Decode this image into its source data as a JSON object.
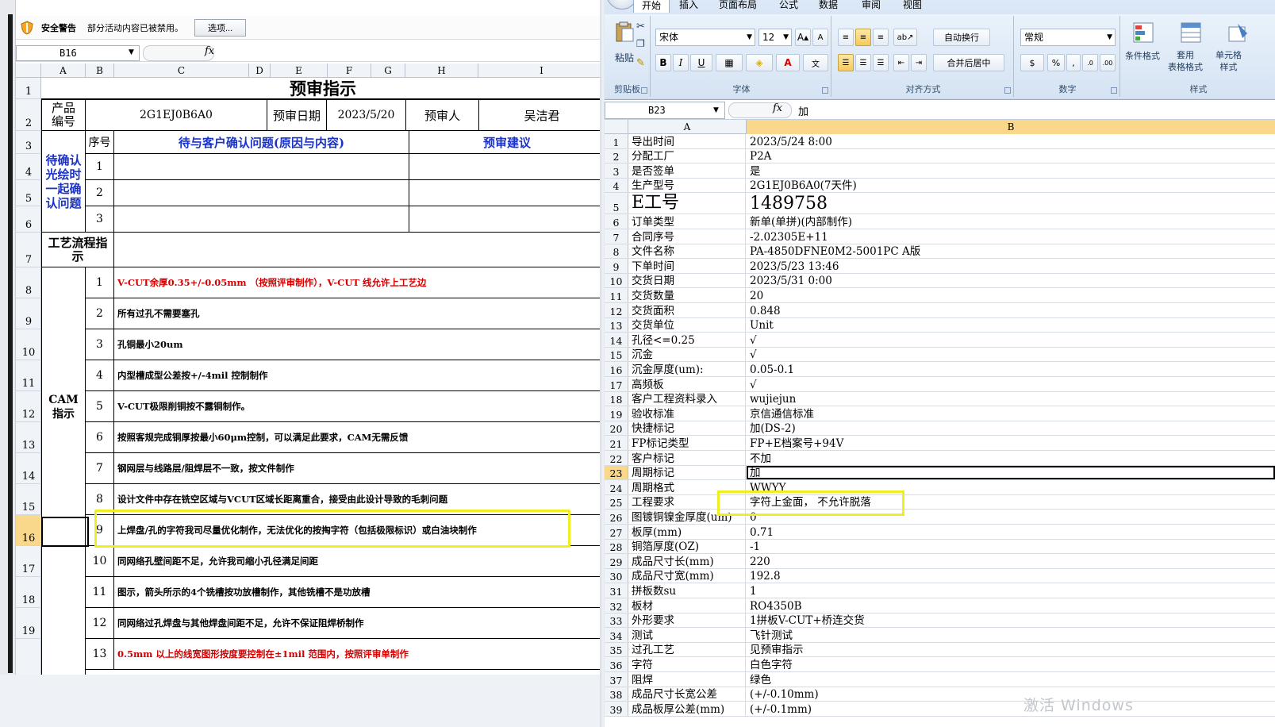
{
  "left": {
    "security_bar": {
      "title": "安全警告",
      "message": "部分活动内容已被禁用。",
      "options_button": "选项..."
    },
    "name_box": "B16",
    "fx_label": "fx",
    "columns": [
      "A",
      "B",
      "C",
      "D",
      "E",
      "F",
      "G",
      "H",
      "I"
    ],
    "rows": [
      "1",
      "2",
      "3",
      "4",
      "5",
      "6",
      "7",
      "8",
      "9",
      "10",
      "11",
      "12",
      "13",
      "14",
      "15",
      "16",
      "17",
      "18",
      "19"
    ],
    "title": "预审指示",
    "product_code_label": "产品编号",
    "product_code": "2G1EJ0B6A0",
    "review_date_label": "预审日期",
    "review_date": "2023/5/20",
    "reviewer_label": "预审人",
    "reviewer": "吴洁君",
    "seq_header": "序号",
    "issue_header": "待与客户确认问题(原因与内容)",
    "suggestion_header": "预审建议",
    "confirm_label": "待确认光绘时一起确认问题",
    "confirm_items": [
      "1",
      "2",
      "3"
    ],
    "process_label": "工艺流程指示",
    "cam_label": "CAM指示",
    "cam_items": [
      {
        "no": "1",
        "text": "V-CUT余厚0.35+/-0.05mm （按照评审制作），V-CUT 线允许上工艺边",
        "color": "#d40000"
      },
      {
        "no": "2",
        "text": "所有过孔不需要塞孔"
      },
      {
        "no": "3",
        "text": "孔铜最小20um"
      },
      {
        "no": "4",
        "text": "内型槽成型公差按+/-4mil 控制制作"
      },
      {
        "no": "5",
        "text": "V-CUT极限削铜按不露铜制作。"
      },
      {
        "no": "6",
        "text": "按照客规完成铜厚按最小60μm控制，可以满足此要求，CAM无需反馈"
      },
      {
        "no": "7",
        "text": "钢网层与线路层/阻焊层不一致，按文件制作"
      },
      {
        "no": "8",
        "text": "设计文件中存在铣空区域与VCUT区域长距离重合，接受由此设计导致的毛刺问题"
      },
      {
        "no": "9",
        "text": "上焊盘/孔的字符我司尽量优化制作，无法优化的按掏字符（包括极限标识）或白油块制作"
      },
      {
        "no": "10",
        "text": "同网络孔壁间距不足，允许我司缩小孔径满足间距"
      },
      {
        "no": "11",
        "text": "图示，箭头所示的4个铣槽按功放槽制作，其他铣槽不是功放槽"
      },
      {
        "no": "12",
        "text": "同网络过孔焊盘与其他焊盘间距不足，允许不保证阻焊桥制作"
      },
      {
        "no": "13",
        "text": "0.5mm 以上的线宽图形按度要控制在±1mil 范围内，按照评审单制作",
        "color": "#d40000"
      }
    ]
  },
  "right": {
    "tabs": [
      "开始",
      "插入",
      "页面布局",
      "公式",
      "数据",
      "审阅",
      "视图"
    ],
    "ribbon": {
      "paste": "粘贴",
      "clipboard": "剪贴板",
      "font_name": "宋体",
      "font_size": "12",
      "font_group": "字体",
      "wrap_text": "自动换行",
      "merge_center": "合并后居中",
      "align_group": "对齐方式",
      "number_format": "常规",
      "number_group": "数字",
      "cond_format": "条件格式",
      "table_format": "套用\n表格格式",
      "cell_style": "单元格\n样式",
      "styles_group": "样式"
    },
    "name_box": "B23",
    "fx_label": "fx",
    "formula_value": "加",
    "columns": [
      "A",
      "B"
    ],
    "rows": [
      {
        "n": "1",
        "a": "导出时间",
        "b": "2023/5/24 8:00"
      },
      {
        "n": "2",
        "a": "分配工厂",
        "b": "P2A"
      },
      {
        "n": "3",
        "a": "是否签单",
        "b": "是"
      },
      {
        "n": "4",
        "a": "生产型号",
        "b": "2G1EJ0B6A0(7天件)"
      },
      {
        "n": "5",
        "a": "E工号",
        "b": "1489758"
      },
      {
        "n": "6",
        "a": "订单类型",
        "b": "新单(单拼)(内部制作)"
      },
      {
        "n": "7",
        "a": "合同序号",
        "b": "-2.02305E+11"
      },
      {
        "n": "8",
        "a": "文件名称",
        "b": "PA-4850DFNE0M2-5001PC A版"
      },
      {
        "n": "9",
        "a": "下单时间",
        "b": "2023/5/23 13:46"
      },
      {
        "n": "10",
        "a": "交货日期",
        "b": "2023/5/31 0:00"
      },
      {
        "n": "11",
        "a": "交货数量",
        "b": "20"
      },
      {
        "n": "12",
        "a": "交货面积",
        "b": "0.848"
      },
      {
        "n": "13",
        "a": "交货单位",
        "b": "Unit"
      },
      {
        "n": "14",
        "a": "孔径<=0.25",
        "b": "√"
      },
      {
        "n": "15",
        "a": "沉金",
        "b": "√"
      },
      {
        "n": "16",
        "a": "沉金厚度(um):",
        "b": "0.05-0.1"
      },
      {
        "n": "17",
        "a": "高频板",
        "b": "√"
      },
      {
        "n": "18",
        "a": "客户工程资料录入",
        "b": "wujiejun"
      },
      {
        "n": "19",
        "a": "验收标准",
        "b": "京信通信标准"
      },
      {
        "n": "20",
        "a": "快捷标记",
        "b": "加(DS-2)"
      },
      {
        "n": "21",
        "a": "FP标记类型",
        "b": "FP+E档案号+94V"
      },
      {
        "n": "22",
        "a": "客户标记",
        "b": "不加"
      },
      {
        "n": "23",
        "a": "周期标记",
        "b": "加"
      },
      {
        "n": "24",
        "a": "周期格式",
        "b": "WWYY"
      },
      {
        "n": "25",
        "a": "工程要求",
        "b": "字符上金面， 不允许脱落"
      },
      {
        "n": "26",
        "a": "图镀铜镍金厚度(um)",
        "b": "0"
      },
      {
        "n": "27",
        "a": "板厚(mm)",
        "b": "0.71"
      },
      {
        "n": "28",
        "a": "铜箔厚度(OZ)",
        "b": "-1"
      },
      {
        "n": "29",
        "a": "成品尺寸长(mm)",
        "b": "220"
      },
      {
        "n": "30",
        "a": "成品尺寸宽(mm)",
        "b": "192.8"
      },
      {
        "n": "31",
        "a": "拼板数su",
        "b": "1"
      },
      {
        "n": "32",
        "a": "板材",
        "b": "RO4350B"
      },
      {
        "n": "33",
        "a": "外形要求",
        "b": "1拼板V-CUT+桥连交货"
      },
      {
        "n": "34",
        "a": "测试",
        "b": "飞针测试"
      },
      {
        "n": "35",
        "a": "过孔工艺",
        "b": "见预审指示"
      },
      {
        "n": "36",
        "a": "字符",
        "b": "白色字符"
      },
      {
        "n": "37",
        "a": "阻焊",
        "b": "绿色"
      },
      {
        "n": "38",
        "a": "成品尺寸长宽公差",
        "b": "(+/-0.10mm)"
      },
      {
        "n": "39",
        "a": "成品板厚公差(mm)",
        "b": "(+/-0.1mm)"
      }
    ]
  },
  "watermark": "激活 Windows",
  "colors": {
    "highlight": "#eeee22",
    "selected_header": "#f9d88c",
    "red_text": "#d40000",
    "blue_text": "#1a32c8"
  }
}
